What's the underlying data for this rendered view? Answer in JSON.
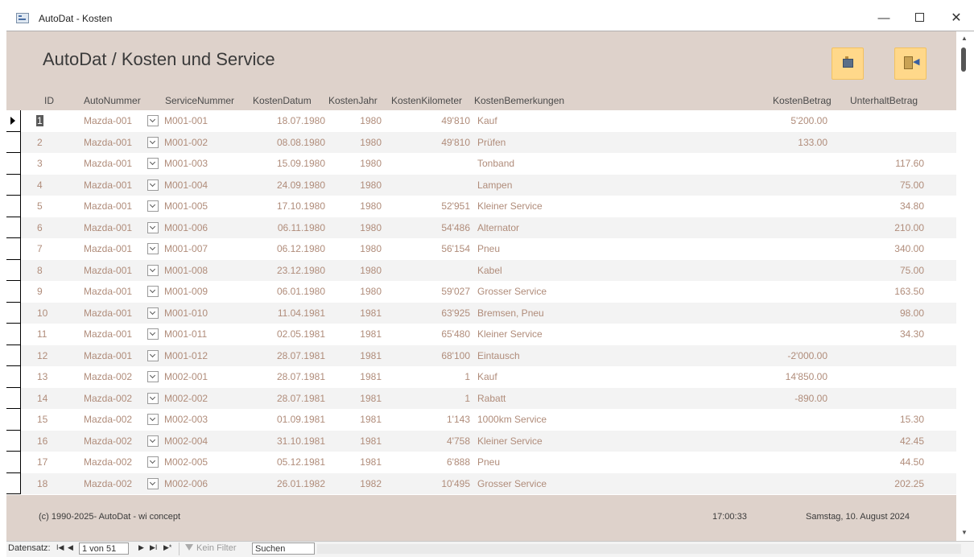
{
  "window": {
    "title": "AutoDat - Kosten",
    "minimize": "—",
    "close": "✕"
  },
  "header": {
    "title": "AutoDat / Kosten und Service",
    "buttons": [
      {
        "icon": "card-icon"
      },
      {
        "icon": "exit-icon"
      }
    ]
  },
  "columns": {
    "id": "ID",
    "auto": "AutoNummer",
    "service": "ServiceNummer",
    "datum": "KostenDatum",
    "jahr": "KostenJahr",
    "km": "KostenKilometer",
    "bem": "KostenBemerkungen",
    "betrag": "KostenBetrag",
    "unterhalt": "UnterhaltBetrag"
  },
  "rows": [
    {
      "id": "1",
      "auto": "Mazda-001",
      "svc": "M001-001",
      "datum": "18.07.1980",
      "jahr": "1980",
      "km": "49'810",
      "bem": "Kauf",
      "kb": "5'200.00",
      "ub": ""
    },
    {
      "id": "2",
      "auto": "Mazda-001",
      "svc": "M001-002",
      "datum": "08.08.1980",
      "jahr": "1980",
      "km": "49'810",
      "bem": "Prüfen",
      "kb": "133.00",
      "ub": ""
    },
    {
      "id": "3",
      "auto": "Mazda-001",
      "svc": "M001-003",
      "datum": "15.09.1980",
      "jahr": "1980",
      "km": "",
      "bem": "Tonband",
      "kb": "",
      "ub": "117.60"
    },
    {
      "id": "4",
      "auto": "Mazda-001",
      "svc": "M001-004",
      "datum": "24.09.1980",
      "jahr": "1980",
      "km": "",
      "bem": "Lampen",
      "kb": "",
      "ub": "75.00"
    },
    {
      "id": "5",
      "auto": "Mazda-001",
      "svc": "M001-005",
      "datum": "17.10.1980",
      "jahr": "1980",
      "km": "52'951",
      "bem": "Kleiner Service",
      "kb": "",
      "ub": "34.80"
    },
    {
      "id": "6",
      "auto": "Mazda-001",
      "svc": "M001-006",
      "datum": "06.11.1980",
      "jahr": "1980",
      "km": "54'486",
      "bem": "Alternator",
      "kb": "",
      "ub": "210.00"
    },
    {
      "id": "7",
      "auto": "Mazda-001",
      "svc": "M001-007",
      "datum": "06.12.1980",
      "jahr": "1980",
      "km": "56'154",
      "bem": "Pneu",
      "kb": "",
      "ub": "340.00"
    },
    {
      "id": "8",
      "auto": "Mazda-001",
      "svc": "M001-008",
      "datum": "23.12.1980",
      "jahr": "1980",
      "km": "",
      "bem": "Kabel",
      "kb": "",
      "ub": "75.00"
    },
    {
      "id": "9",
      "auto": "Mazda-001",
      "svc": "M001-009",
      "datum": "06.01.1980",
      "jahr": "1980",
      "km": "59'027",
      "bem": "Grosser Service",
      "kb": "",
      "ub": "163.50"
    },
    {
      "id": "10",
      "auto": "Mazda-001",
      "svc": "M001-010",
      "datum": "11.04.1981",
      "jahr": "1981",
      "km": "63'925",
      "bem": "Bremsen, Pneu",
      "kb": "",
      "ub": "98.00"
    },
    {
      "id": "11",
      "auto": "Mazda-001",
      "svc": "M001-011",
      "datum": "02.05.1981",
      "jahr": "1981",
      "km": "65'480",
      "bem": "Kleiner Service",
      "kb": "",
      "ub": "34.30"
    },
    {
      "id": "12",
      "auto": "Mazda-001",
      "svc": "M001-012",
      "datum": "28.07.1981",
      "jahr": "1981",
      "km": "68'100",
      "bem": "Eintausch",
      "kb": "-2'000.00",
      "ub": ""
    },
    {
      "id": "13",
      "auto": "Mazda-002",
      "svc": "M002-001",
      "datum": "28.07.1981",
      "jahr": "1981",
      "km": "1",
      "bem": "Kauf",
      "kb": "14'850.00",
      "ub": ""
    },
    {
      "id": "14",
      "auto": "Mazda-002",
      "svc": "M002-002",
      "datum": "28.07.1981",
      "jahr": "1981",
      "km": "1",
      "bem": "Rabatt",
      "kb": "-890.00",
      "ub": ""
    },
    {
      "id": "15",
      "auto": "Mazda-002",
      "svc": "M002-003",
      "datum": "01.09.1981",
      "jahr": "1981",
      "km": "1'143",
      "bem": "1000km Service",
      "kb": "",
      "ub": "15.30"
    },
    {
      "id": "16",
      "auto": "Mazda-002",
      "svc": "M002-004",
      "datum": "31.10.1981",
      "jahr": "1981",
      "km": "4'758",
      "bem": "Kleiner Service",
      "kb": "",
      "ub": "42.45"
    },
    {
      "id": "17",
      "auto": "Mazda-002",
      "svc": "M002-005",
      "datum": "05.12.1981",
      "jahr": "1981",
      "km": "6'888",
      "bem": "Pneu",
      "kb": "",
      "ub": "44.50"
    },
    {
      "id": "18",
      "auto": "Mazda-002",
      "svc": "M002-006",
      "datum": "26.01.1982",
      "jahr": "1982",
      "km": "10'495",
      "bem": "Grosser Service",
      "kb": "",
      "ub": "202.25"
    }
  ],
  "footer": {
    "copyright": "(c) 1990-2025- AutoDat - wi concept",
    "time": "17:00:33",
    "date": "Samstag, 10. August 2024"
  },
  "nav": {
    "label": "Datensatz:",
    "first": "I◀",
    "prev": "◀",
    "record": "1 von 51",
    "next": "▶",
    "last": "▶I",
    "new": "▶*",
    "filter": "Kein Filter",
    "search": "Suchen"
  },
  "colors": {
    "header_bg": "#ded2cb",
    "button_bg": "#ffd88a",
    "cell_text": "#b08c7a"
  }
}
